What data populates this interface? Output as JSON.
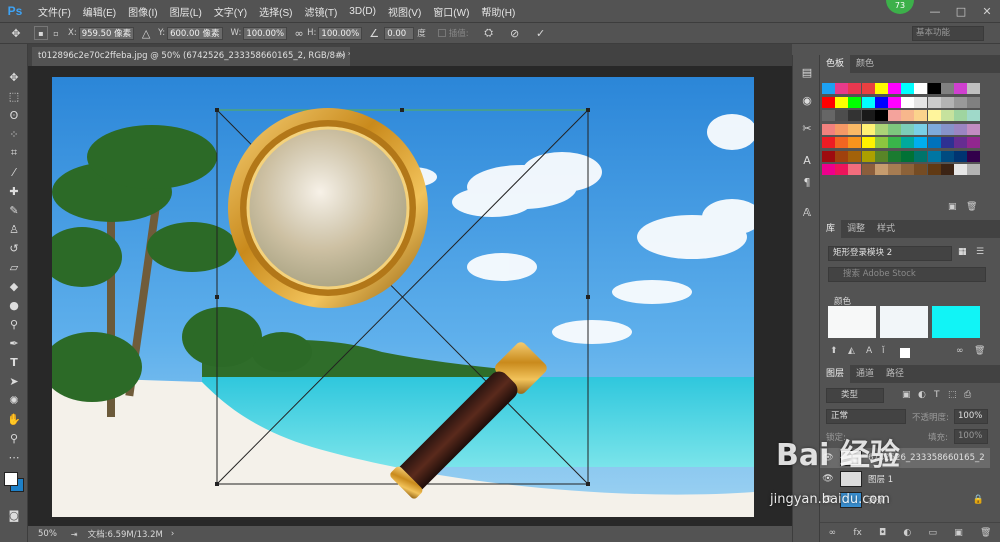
{
  "app": {
    "logo": "Ps",
    "badge": "73"
  },
  "menu": [
    "文件(F)",
    "编辑(E)",
    "图像(I)",
    "图层(L)",
    "文字(Y)",
    "选择(S)",
    "滤镜(T)",
    "3D(D)",
    "视图(V)",
    "窗口(W)",
    "帮助(H)"
  ],
  "window_controls": {
    "minimize": "—",
    "restore": "□",
    "close": "✕"
  },
  "options": {
    "x_label": "X:",
    "x_value": "959.50 像素",
    "y_label": "Y:",
    "y_value": "600.00 像素",
    "w_label": "W:",
    "w_value": "100.00%",
    "h_label": "H:",
    "h_value": "100.00%",
    "angle_value": "0.00",
    "angle_unit": "度",
    "interp_label": "插值:",
    "workspace": "基本功能"
  },
  "document": {
    "tab_title": "t012896c2e70c2ffeba.jpg @ 50% (6742526_233358660165_2, RGB/8#) *",
    "close": "×"
  },
  "status": {
    "zoom": "50%",
    "doc_info": "文档:6.59M/13.2M"
  },
  "panels": {
    "swatches_tabs": [
      "色板",
      "颜色"
    ],
    "library_tabs": [
      "库",
      "调整",
      "样式"
    ],
    "library_select": "矩形登录模块 2",
    "library_search": "搜索 Adobe Stock",
    "library_colors_label": "颜色",
    "library_colors": [
      "#f7f8f8",
      "#f2f6f9",
      "#11f4f6"
    ],
    "layers_tabs": [
      "图层",
      "通道",
      "路径"
    ],
    "layer_kind": "类型",
    "blend_mode": "正常",
    "opacity_label": "不透明度:",
    "opacity_value": "100%",
    "lock_label": "锁定:",
    "fill_label": "填充:",
    "fill_value": "100%",
    "layers": [
      {
        "name": "6742526_233358660165_2",
        "selected": true
      },
      {
        "name": "图层 1",
        "selected": false
      },
      {
        "name": "背景",
        "selected": false,
        "locked": true
      }
    ]
  },
  "watermark": {
    "brand": "Bai 经验",
    "url": "jingyan.baidu.com"
  }
}
